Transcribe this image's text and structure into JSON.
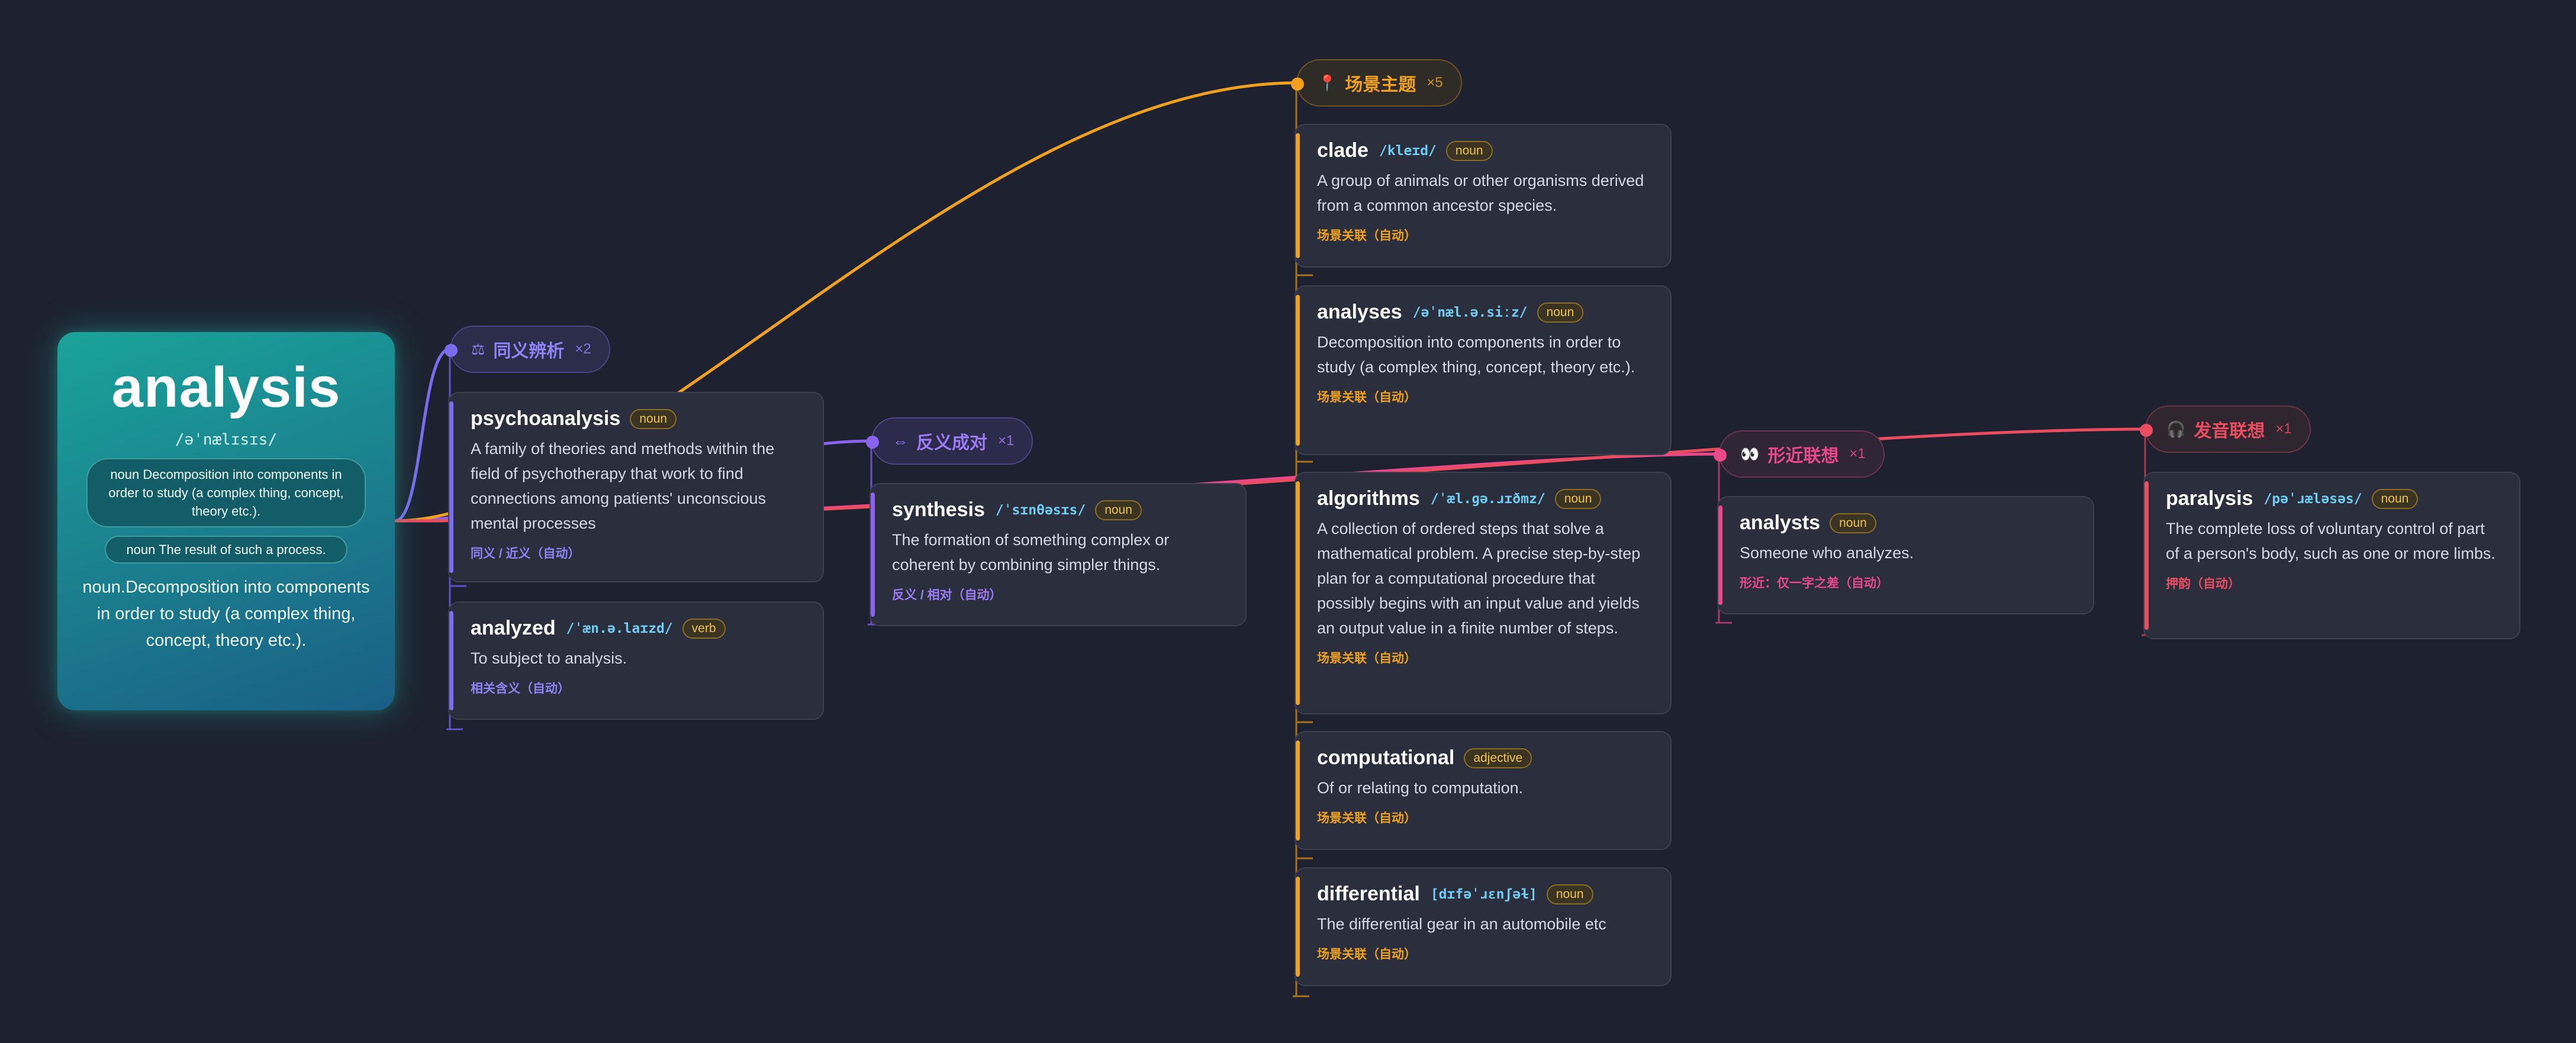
{
  "colors": {
    "background": "#1e2130",
    "purple": "#7c6cf0",
    "orange": "#f0a21f",
    "pink": "#e9498a",
    "red": "#ea4c60",
    "teal": "#1aa39a"
  },
  "root": {
    "word": "analysis",
    "phonetic": "/əˈnælɪsɪs/",
    "chips": [
      "noun Decomposition into components in order to study (a complex thing, concept, theory etc.).",
      "noun The result of such a process."
    ],
    "definition": "noun.Decomposition into components in order to study (a complex thing, concept, theory etc.)."
  },
  "groups": {
    "synonym": {
      "icon": "scales-icon",
      "glyph": "⚖",
      "label": "同义辨析",
      "count": "×2",
      "cards": [
        {
          "word": "psychoanalysis",
          "phonetic": "",
          "pos": "noun",
          "definition": "A family of theories and methods within the field of psychotherapy that work to find connections among patients' unconscious mental processes",
          "tag": "同义 / 近义（自动）"
        },
        {
          "word": "analyzed",
          "phonetic": "/ˈæn.ə.laɪzd/",
          "pos": "verb",
          "definition": "To subject to analysis.",
          "tag": "相关含义（自动）"
        }
      ]
    },
    "antonym": {
      "icon": "swap-arrows-icon",
      "glyph": "⇔",
      "label": "反义成对",
      "count": "×1",
      "cards": [
        {
          "word": "synthesis",
          "phonetic": "/ˈsɪnθəsɪs/",
          "pos": "noun",
          "definition": "The formation of something complex or coherent by combining simpler things.",
          "tag": "反义 / 相对（自动）"
        }
      ]
    },
    "scene": {
      "icon": "pin-icon",
      "glyph": "📍",
      "label": "场景主题",
      "count": "×5",
      "cards": [
        {
          "word": "clade",
          "phonetic": "/kleɪd/",
          "pos": "noun",
          "definition": "A group of animals or other organisms derived from a common ancestor species.",
          "tag": "场景关联（自动）"
        },
        {
          "word": "analyses",
          "phonetic": "/əˈnæl.ə.siːz/",
          "pos": "noun",
          "definition": "Decomposition into components in order to study (a complex thing, concept, theory etc.).",
          "tag": "场景关联（自动）"
        },
        {
          "word": "algorithms",
          "phonetic": "/ˈæl.ɡə.ɹɪðmz/",
          "pos": "noun",
          "definition": "A collection of ordered steps that solve a mathematical problem. A precise step-by-step plan for a computational procedure that possibly begins with an input value and yields an output value in a finite number of steps.",
          "tag": "场景关联（自动）"
        },
        {
          "word": "computational",
          "phonetic": "",
          "pos": "adjective",
          "definition": "Of or relating to computation.",
          "tag": "场景关联（自动）"
        },
        {
          "word": "differential",
          "phonetic": "[dɪfəˈɹɛnʃəɫ]",
          "pos": "noun",
          "definition": "The differential gear in an automobile etc",
          "tag": "场景关联（自动）"
        }
      ]
    },
    "form": {
      "icon": "eyes-icon",
      "glyph": "👀",
      "label": "形近联想",
      "count": "×1",
      "cards": [
        {
          "word": "analysts",
          "phonetic": "",
          "pos": "noun",
          "definition": "Someone who analyzes.",
          "tag": "形近：仅一字之差（自动）"
        }
      ]
    },
    "sound": {
      "icon": "headphones-icon",
      "glyph": "🎧",
      "label": "发音联想",
      "count": "×1",
      "cards": [
        {
          "word": "paralysis",
          "phonetic": "/pəˈɹæləsəs/",
          "pos": "noun",
          "definition": "The complete loss of voluntary control of part of a person's body, such as one or more limbs.",
          "tag": "押韵（自动）"
        }
      ]
    }
  }
}
